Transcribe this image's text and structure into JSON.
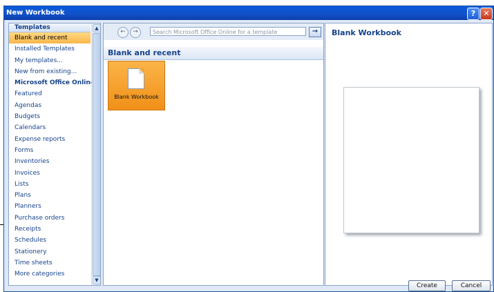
{
  "window": {
    "title": "New Workbook",
    "help_glyph": "?",
    "close_glyph": "✕"
  },
  "templates": {
    "header": "Templates",
    "items": [
      "Blank and recent",
      "Installed Templates",
      "My templates...",
      "New from existing...",
      "Microsoft Office Online",
      "Featured",
      "Agendas",
      "Budgets",
      "Calendars",
      "Expense reports",
      "Forms",
      "Inventories",
      "Invoices",
      "Lists",
      "Plans",
      "Planners",
      "Purchase orders",
      "Receipts",
      "Schedules",
      "Stationery",
      "Time sheets",
      "More categories"
    ],
    "selected_index": 0,
    "bold_index": 4
  },
  "nav": {
    "back_glyph": "←",
    "forward_glyph": "→",
    "search_placeholder": "Search Microsoft Office Online for a template",
    "go_glyph": "→"
  },
  "middle": {
    "section_title": "Blank and recent",
    "tile_label": "Blank Workbook"
  },
  "preview": {
    "title": "Blank Workbook"
  },
  "buttons": {
    "create": "Create",
    "cancel": "Cancel"
  },
  "colors": {
    "titlebar": "#0a5bdc",
    "selected_item": "#f8b64c",
    "tile": "#f19018",
    "accent_text": "#15428b"
  }
}
